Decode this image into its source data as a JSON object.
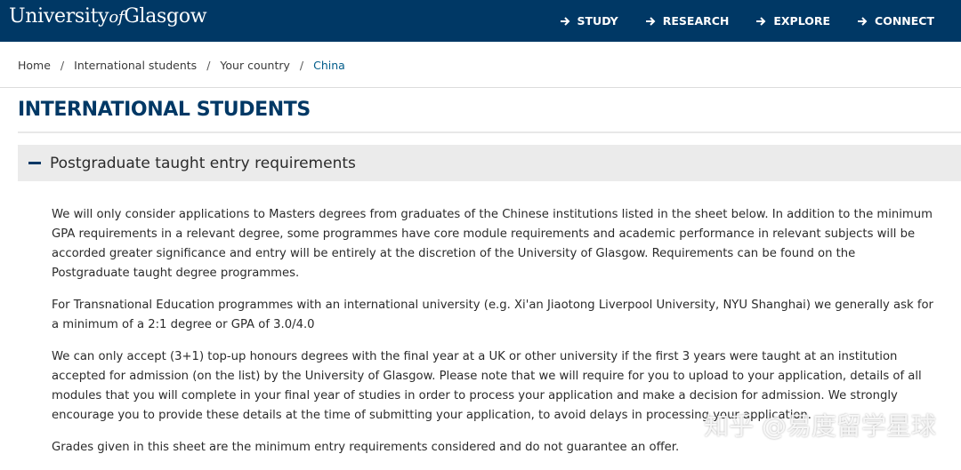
{
  "header": {
    "logo_part1": "University",
    "logo_of": "of",
    "logo_part2": "Glasgow",
    "nav": [
      {
        "label": "STUDY"
      },
      {
        "label": "RESEARCH"
      },
      {
        "label": "EXPLORE"
      },
      {
        "label": "CONNECT"
      }
    ]
  },
  "breadcrumb": {
    "items": [
      "Home",
      "International students",
      "Your country",
      "China"
    ],
    "separator": "/"
  },
  "page_title": "INTERNATIONAL STUDENTS",
  "accordion": {
    "title": "Postgraduate taught entry requirements",
    "paragraphs": [
      "We will only consider applications to Masters degrees from graduates of the Chinese institutions listed in the sheet below. In addition to the minimum GPA requirements in a relevant degree, some programmes have core module requirements and academic performance in relevant subjects will be accorded greater significance and entry will be entirely at the discretion of the University of Glasgow. Requirements can be found on the Postgraduate taught degree programmes.",
      "For Transnational Education programmes with an international university (e.g. Xi'an Jiaotong Liverpool University, NYU Shanghai) we generally ask for a minimum of a 2:1 degree or GPA of 3.0/4.0",
      "We can only accept (3+1) top-up honours degrees with the final year at a UK or other university if the first 3 years were taught at an institution accepted for admission (on the list) by the University of Glasgow.  Please note that we will require for you to upload to your application, details of all modules that you will complete in your final year of studies in order to process your application and make a decision for admission. We strongly encourage you to provide these details at the time of submitting your application, to avoid delays in processing your application.",
      "Grades given in this sheet are the minimum entry requirements considered and do not guarantee an offer."
    ]
  },
  "watermark": "知乎 @易度留学星球",
  "colors": {
    "brand": "#003865",
    "accordion_bg": "#ebebeb",
    "link": "#005c8a"
  }
}
